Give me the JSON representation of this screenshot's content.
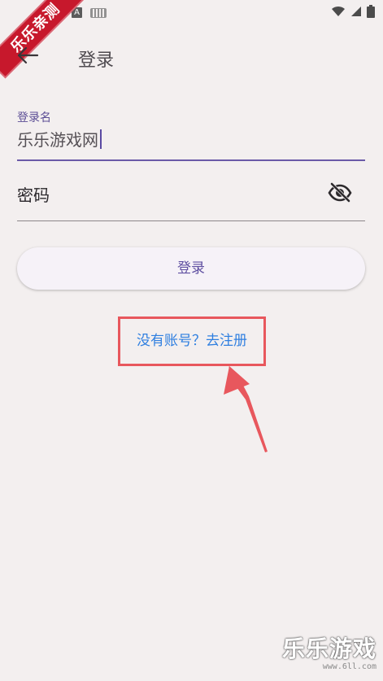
{
  "status_bar": {
    "a_icon": "A",
    "keyboard_icon": "keyboard-icon",
    "wifi_icon": "wifi-icon",
    "signal_icon": "signal-icon",
    "battery_icon": "battery-icon"
  },
  "badge": {
    "text": "乐乐亲测"
  },
  "app_bar": {
    "back_icon": "arrow-left-icon",
    "title": "登录"
  },
  "form": {
    "username": {
      "label": "登录名",
      "value": "乐乐游戏网"
    },
    "password": {
      "label": "密码",
      "toggle_icon": "visibility-off-icon"
    },
    "login_button": "登录",
    "register_link": "没有账号？去注册"
  },
  "watermark": {
    "title": "乐乐游戏",
    "url": "www.6ll.com"
  },
  "colors": {
    "background": "#f3efef",
    "accent": "#6a5aa8",
    "link": "#2f7fe0",
    "highlight": "#e8575d",
    "badge": "#c7182c"
  }
}
